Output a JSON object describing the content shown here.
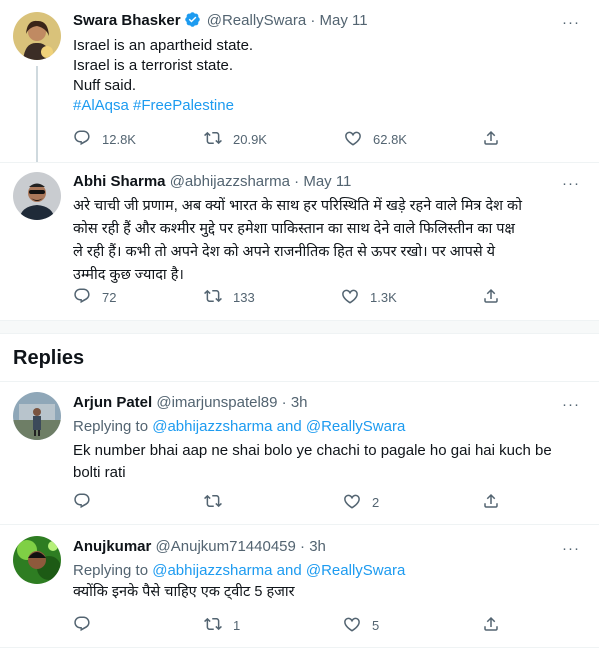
{
  "tweets": [
    {
      "display_name": "Swara Bhasker",
      "handle": "@ReallySwara",
      "sep": "·",
      "date": "May 11",
      "verified": true,
      "lines": [
        "Israel is an apartheid state.",
        "Israel is a terrorist state.",
        "Nuff said."
      ],
      "hashtags": "#AlAqsa #FreePalestine",
      "reply_count": "12.8K",
      "retweet_count": "20.9K",
      "like_count": "62.8K"
    },
    {
      "display_name": "Abhi Sharma",
      "handle": "@abhijazzsharma",
      "sep": "·",
      "date": "May 11",
      "lines": [
        "अरे चाची जी प्रणाम, अब क्यों भारत के साथ हर परिस्थिति में खड़े रहने वाले मित्र देश को",
        "कोस रही हैं और कश्मीर मुद्दे पर हमेशा पाकिस्तान का साथ देने वाले फिलिस्तीन का पक्ष",
        "ले रही हैं। कभी तो अपने देश को अपने राजनीतिक हित से ऊपर रखो। पर आपसे ये",
        "उम्मीद कुछ ज्यादा है।"
      ],
      "reply_count": "72",
      "retweet_count": "133",
      "like_count": "1.3K"
    }
  ],
  "replies_heading": "Replies",
  "replies": [
    {
      "display_name": "Arjun Patel",
      "handle": "@imarjunspatel89",
      "sep": "·",
      "time": "3h",
      "replying_prefix": "Replying to",
      "replying_user1": "@abhijazzsharma",
      "replying_and": "and",
      "replying_user2": "@ReallySwara",
      "lines": [
        "Ek number bhai aap ne shai bolo ye chachi to pagale ho gai hai kuch be",
        "bolti rati"
      ],
      "reply_count": "",
      "retweet_count": "",
      "like_count": "2"
    },
    {
      "display_name": "Anujkumar",
      "handle": "@Anujkum71440459",
      "sep": "·",
      "time": "3h",
      "replying_prefix": "Replying to",
      "replying_user1": "@abhijazzsharma",
      "replying_and": "and",
      "replying_user2": "@ReallySwara",
      "lines": [
        "क्योंकि इनके पैसे चाहिए एक ट्वीट 5 हजार"
      ],
      "reply_count": "",
      "retweet_count": "1",
      "like_count": "5"
    }
  ],
  "icons": {
    "reply": "reply-icon",
    "retweet": "retweet-icon",
    "like": "like-icon",
    "share": "share-icon",
    "more": "more-icon",
    "verified": "verified-badge-icon"
  },
  "colors": {
    "link": "#1d9bf0",
    "muted": "#536471",
    "verified": "#1d9bf0"
  }
}
